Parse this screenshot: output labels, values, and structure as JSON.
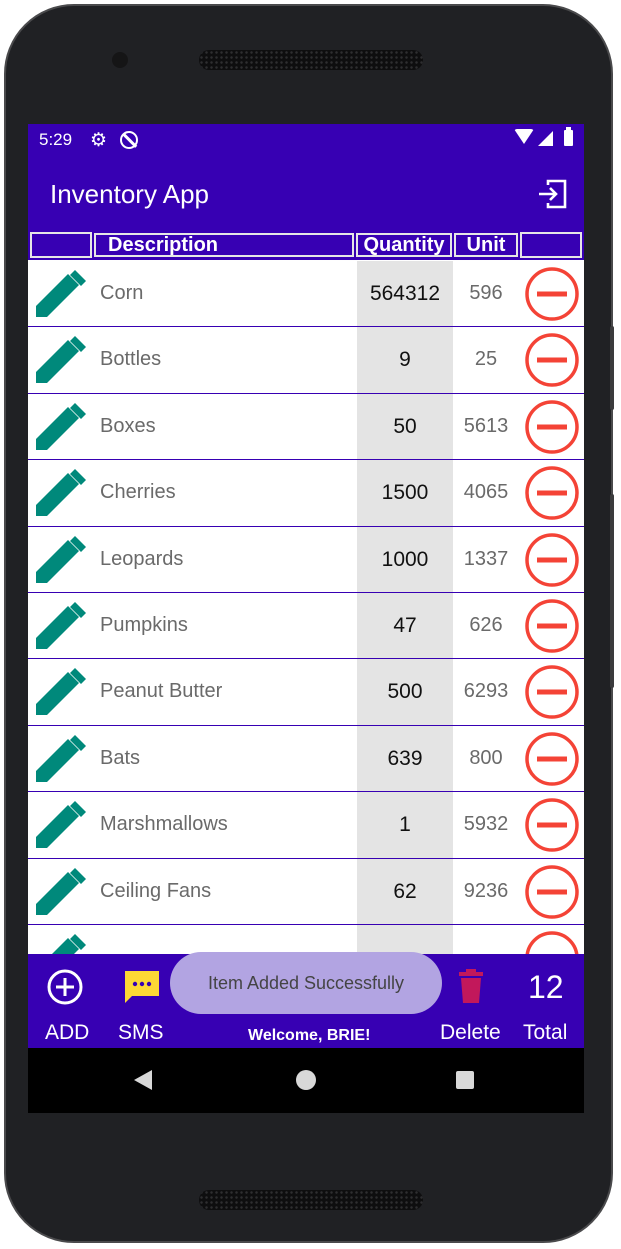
{
  "status_bar": {
    "time": "5:29",
    "icons": [
      "gear-icon",
      "sync-off-icon",
      "wifi-icon",
      "cell-signal-icon",
      "battery-icon"
    ]
  },
  "app_bar": {
    "title": "Inventory App",
    "action_icon": "exit-icon"
  },
  "table_header": {
    "description": "Description",
    "quantity": "Quantity",
    "unit": "Unit"
  },
  "items": [
    {
      "name": "Corn",
      "quantity": "564312",
      "unit": "596"
    },
    {
      "name": "Bottles",
      "quantity": "9",
      "unit": "25"
    },
    {
      "name": "Boxes",
      "quantity": "50",
      "unit": "5613"
    },
    {
      "name": "Cherries",
      "quantity": "1500",
      "unit": "4065"
    },
    {
      "name": "Leopards",
      "quantity": "1000",
      "unit": "1337"
    },
    {
      "name": "Pumpkins",
      "quantity": "47",
      "unit": "626"
    },
    {
      "name": "Peanut Butter",
      "quantity": "500",
      "unit": "6293"
    },
    {
      "name": "Bats",
      "quantity": "639",
      "unit": "800"
    },
    {
      "name": "Marshmallows",
      "quantity": "1",
      "unit": "5932"
    },
    {
      "name": "Ceiling Fans",
      "quantity": "62",
      "unit": "9236"
    }
  ],
  "bottom_bar": {
    "add_label": "ADD",
    "sms_label": "SMS",
    "welcome": "Welcome, BRIE!",
    "delete_label": "Delete",
    "total_count": "12",
    "total_label": "Total"
  },
  "toast": {
    "message": "Item Added Successfully"
  },
  "colors": {
    "primary": "#3700b3",
    "edit_icon": "#00897b",
    "delete_icon": "#f44336",
    "sms_icon": "#fdd835",
    "trash_icon": "#c2185b",
    "toast_bg": "#b2a4e2"
  }
}
